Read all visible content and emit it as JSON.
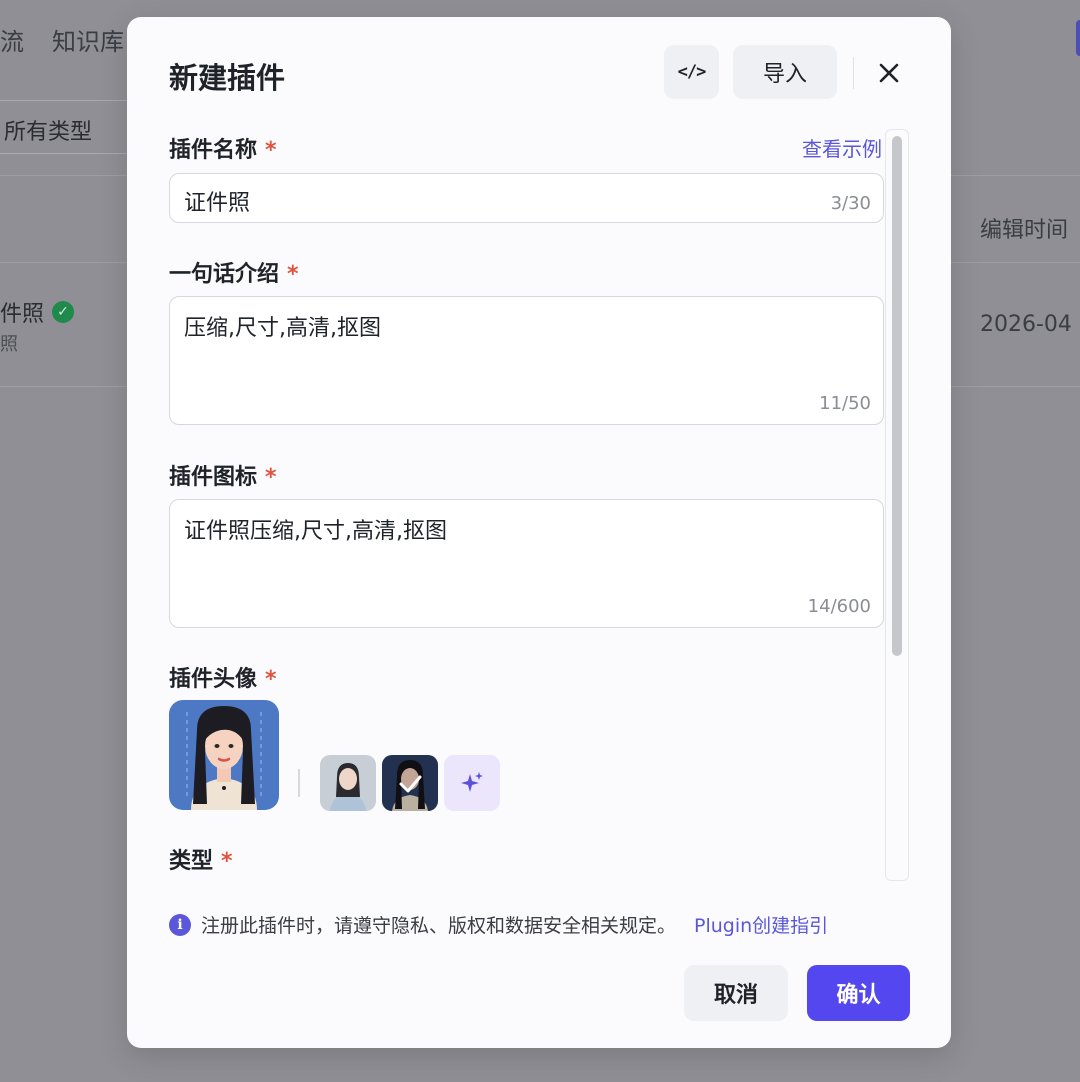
{
  "background": {
    "nav_items": [
      "流",
      "知识库"
    ],
    "filter_label": "所有类型",
    "column_header": "编辑时间",
    "row_name": "件照",
    "row_sub": "照",
    "row_date": "2026-04"
  },
  "modal": {
    "title": "新建插件",
    "code_button_label": "</>",
    "import_button_label": "导入",
    "close_label": "✕",
    "example_link": "查看示例",
    "required_mark": "*",
    "name_field": {
      "label": "插件名称",
      "value": "证件照",
      "counter": "3/30"
    },
    "intro_field": {
      "label": "一句话介绍",
      "value": "压缩,尺寸,高清,抠图",
      "counter": "11/50"
    },
    "icon_field": {
      "label": "插件图标",
      "value": "证件照压缩,尺寸,高清,抠图",
      "counter": "14/600"
    },
    "avatar_field": {
      "label": "插件头像"
    },
    "type_field": {
      "label": "类型"
    },
    "notice_text": "注册此插件时，请遵守隐私、版权和数据安全相关规定。",
    "notice_link": "Plugin创建指引",
    "cancel_label": "取消",
    "confirm_label": "确认"
  },
  "colors": {
    "accent": "#5447f0",
    "link": "#5b57d9",
    "required": "#e0533d"
  }
}
